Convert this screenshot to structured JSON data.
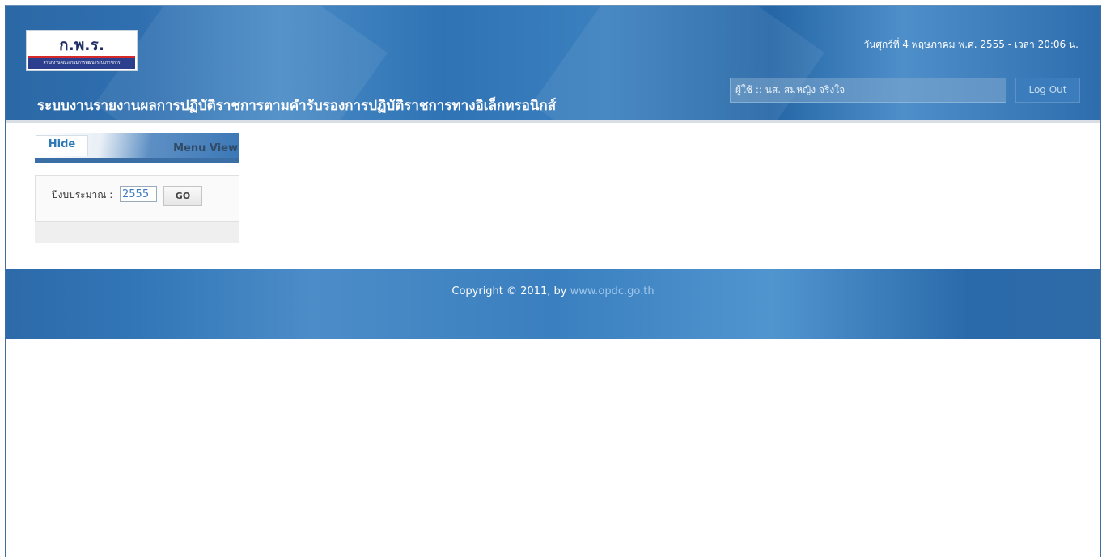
{
  "header": {
    "logo_mark": "ก.พ.ร.",
    "logo_sub": "สำนักงานคณะกรรมการพัฒนาระบบราชการ",
    "date": "วันศุกร์ที่ 4 พฤษภาคม พ.ศ. 2555 - เวลา 20:06 น.",
    "title": "ระบบงานรายงานผลการปฏิบัติราชการตามคำรับรองการปฏิบัติราชการทางอิเล็กทรอนิกส์",
    "user": "ผู้ใช้ :: นส. สมหญิง จริงใจ",
    "logout_label": "Log Out"
  },
  "sidebar": {
    "hide_label": "Hide",
    "menu_view_label": "Menu View",
    "budget_label": "ปีงบประมาณ :",
    "budget_value": "2555",
    "go_label": "GO"
  },
  "footer": {
    "copyright": "Copyright © 2011, by ",
    "link": "www.opdc.go.th"
  },
  "colors": {
    "header_blue": "#2f6fb0",
    "accent_link": "#2c79b6"
  }
}
